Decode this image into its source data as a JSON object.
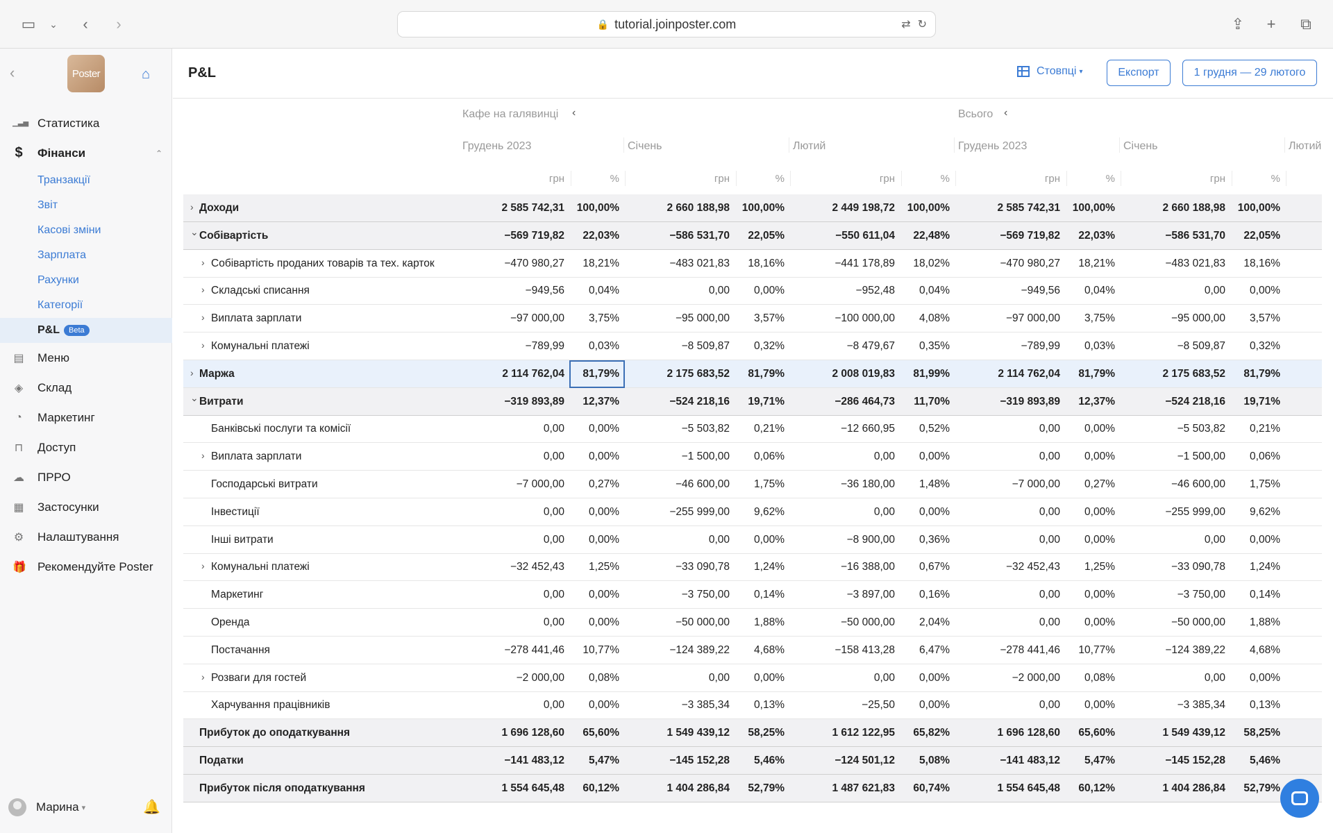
{
  "browser": {
    "url": "tutorial.joinposter.com"
  },
  "sidebar": {
    "logo_text": "Poster",
    "items": [
      {
        "label": "Статистика",
        "icon": "bar-chart-icon"
      },
      {
        "label": "Фінанси",
        "icon": "dollar-icon",
        "expanded": true,
        "children": [
          {
            "label": "Транзакції"
          },
          {
            "label": "Звіт"
          },
          {
            "label": "Касові зміни"
          },
          {
            "label": "Зарплата"
          },
          {
            "label": "Рахунки"
          },
          {
            "label": "Категорії"
          },
          {
            "label": "P&L",
            "badge": "Beta",
            "active": true
          }
        ]
      },
      {
        "label": "Меню",
        "icon": "document-icon"
      },
      {
        "label": "Склад",
        "icon": "layers-icon"
      },
      {
        "label": "Маркетинг",
        "icon": "pie-icon"
      },
      {
        "label": "Доступ",
        "icon": "lock-icon"
      },
      {
        "label": "ПРРО",
        "icon": "cloud-icon"
      },
      {
        "label": "Застосунки",
        "icon": "apps-icon"
      },
      {
        "label": "Налаштування",
        "icon": "gear-icon"
      },
      {
        "label": "Рекомендуйте Poster",
        "icon": "gift-icon"
      }
    ],
    "user": "Марина"
  },
  "header": {
    "title": "P&L",
    "columns_label": "Стовпці",
    "export_label": "Експорт",
    "date_range": "1 грудня — 29 лютого"
  },
  "table": {
    "groups": [
      "Кафе на галявинці",
      "Всього"
    ],
    "months": [
      "Грудень 2023",
      "Січень",
      "Лютий",
      "Грудень 2023",
      "Січень",
      "Лютий"
    ],
    "unit_money": "грн",
    "unit_pct": "%",
    "rows": [
      {
        "label": "Доходи",
        "type": "section",
        "chevron": "›",
        "indent": 0,
        "values": [
          "2 585 742,31",
          "100,00%",
          "2 660 188,98",
          "100,00%",
          "2 449 198,72",
          "100,00%",
          "2 585 742,31",
          "100,00%",
          "2 660 188,98",
          "100,00%"
        ]
      },
      {
        "label": "Собівартість",
        "type": "section",
        "chevron": "⌄",
        "indent": 0,
        "values": [
          "−569 719,82",
          "22,03%",
          "−586 531,70",
          "22,05%",
          "−550 611,04",
          "22,48%",
          "−569 719,82",
          "22,03%",
          "−586 531,70",
          "22,05%"
        ]
      },
      {
        "label": "Собівартість проданих товарів та тех. карток",
        "type": "item",
        "chevron": "›",
        "indent": 1,
        "values": [
          "−470 980,27",
          "18,21%",
          "−483 021,83",
          "18,16%",
          "−441 178,89",
          "18,02%",
          "−470 980,27",
          "18,21%",
          "−483 021,83",
          "18,16%"
        ]
      },
      {
        "label": "Складські списання",
        "type": "item",
        "chevron": "›",
        "indent": 1,
        "values": [
          "−949,56",
          "0,04%",
          "0,00",
          "0,00%",
          "−952,48",
          "0,04%",
          "−949,56",
          "0,04%",
          "0,00",
          "0,00%"
        ]
      },
      {
        "label": "Виплата зарплати",
        "type": "item",
        "chevron": "›",
        "indent": 1,
        "values": [
          "−97 000,00",
          "3,75%",
          "−95 000,00",
          "3,57%",
          "−100 000,00",
          "4,08%",
          "−97 000,00",
          "3,75%",
          "−95 000,00",
          "3,57%"
        ]
      },
      {
        "label": "Комунальні платежі",
        "type": "item",
        "chevron": "›",
        "indent": 1,
        "values": [
          "−789,99",
          "0,03%",
          "−8 509,87",
          "0,32%",
          "−8 479,67",
          "0,35%",
          "−789,99",
          "0,03%",
          "−8 509,87",
          "0,32%"
        ]
      },
      {
        "label": "Маржа",
        "type": "highlight",
        "chevron": "›",
        "indent": 0,
        "values": [
          "2 114 762,04",
          "81,79%",
          "2 175 683,52",
          "81,79%",
          "2 008 019,83",
          "81,99%",
          "2 114 762,04",
          "81,79%",
          "2 175 683,52",
          "81,79%"
        ]
      },
      {
        "label": "Витрати",
        "type": "section",
        "chevron": "⌄",
        "indent": 0,
        "values": [
          "−319 893,89",
          "12,37%",
          "−524 218,16",
          "19,71%",
          "−286 464,73",
          "11,70%",
          "−319 893,89",
          "12,37%",
          "−524 218,16",
          "19,71%"
        ]
      },
      {
        "label": "Банківські послуги та комісії",
        "type": "item",
        "chevron": "",
        "indent": 1,
        "values": [
          "0,00",
          "0,00%",
          "−5 503,82",
          "0,21%",
          "−12 660,95",
          "0,52%",
          "0,00",
          "0,00%",
          "−5 503,82",
          "0,21%"
        ]
      },
      {
        "label": "Виплата зарплати",
        "type": "item",
        "chevron": "›",
        "indent": 1,
        "values": [
          "0,00",
          "0,00%",
          "−1 500,00",
          "0,06%",
          "0,00",
          "0,00%",
          "0,00",
          "0,00%",
          "−1 500,00",
          "0,06%"
        ]
      },
      {
        "label": "Господарські витрати",
        "type": "item",
        "chevron": "",
        "indent": 1,
        "values": [
          "−7 000,00",
          "0,27%",
          "−46 600,00",
          "1,75%",
          "−36 180,00",
          "1,48%",
          "−7 000,00",
          "0,27%",
          "−46 600,00",
          "1,75%"
        ]
      },
      {
        "label": "Інвестиції",
        "type": "item",
        "chevron": "",
        "indent": 1,
        "values": [
          "0,00",
          "0,00%",
          "−255 999,00",
          "9,62%",
          "0,00",
          "0,00%",
          "0,00",
          "0,00%",
          "−255 999,00",
          "9,62%"
        ]
      },
      {
        "label": "Інші витрати",
        "type": "item",
        "chevron": "",
        "indent": 1,
        "values": [
          "0,00",
          "0,00%",
          "0,00",
          "0,00%",
          "−8 900,00",
          "0,36%",
          "0,00",
          "0,00%",
          "0,00",
          "0,00%"
        ]
      },
      {
        "label": "Комунальні платежі",
        "type": "item",
        "chevron": "›",
        "indent": 1,
        "values": [
          "−32 452,43",
          "1,25%",
          "−33 090,78",
          "1,24%",
          "−16 388,00",
          "0,67%",
          "−32 452,43",
          "1,25%",
          "−33 090,78",
          "1,24%"
        ]
      },
      {
        "label": "Маркетинг",
        "type": "item",
        "chevron": "",
        "indent": 1,
        "values": [
          "0,00",
          "0,00%",
          "−3 750,00",
          "0,14%",
          "−3 897,00",
          "0,16%",
          "0,00",
          "0,00%",
          "−3 750,00",
          "0,14%"
        ]
      },
      {
        "label": "Оренда",
        "type": "item",
        "chevron": "",
        "indent": 1,
        "values": [
          "0,00",
          "0,00%",
          "−50 000,00",
          "1,88%",
          "−50 000,00",
          "2,04%",
          "0,00",
          "0,00%",
          "−50 000,00",
          "1,88%"
        ]
      },
      {
        "label": "Постачання",
        "type": "item",
        "chevron": "",
        "indent": 1,
        "values": [
          "−278 441,46",
          "10,77%",
          "−124 389,22",
          "4,68%",
          "−158 413,28",
          "6,47%",
          "−278 441,46",
          "10,77%",
          "−124 389,22",
          "4,68%"
        ]
      },
      {
        "label": "Розваги для гостей",
        "type": "item",
        "chevron": "›",
        "indent": 1,
        "values": [
          "−2 000,00",
          "0,08%",
          "0,00",
          "0,00%",
          "0,00",
          "0,00%",
          "−2 000,00",
          "0,08%",
          "0,00",
          "0,00%"
        ]
      },
      {
        "label": "Харчування працівників",
        "type": "item",
        "chevron": "",
        "indent": 1,
        "values": [
          "0,00",
          "0,00%",
          "−3 385,34",
          "0,13%",
          "−25,50",
          "0,00%",
          "0,00",
          "0,00%",
          "−3 385,34",
          "0,13%"
        ]
      },
      {
        "label": "Прибуток до оподаткування",
        "type": "total",
        "chevron": "",
        "indent": 0,
        "values": [
          "1 696 128,60",
          "65,60%",
          "1 549 439,12",
          "58,25%",
          "1 612 122,95",
          "65,82%",
          "1 696 128,60",
          "65,60%",
          "1 549 439,12",
          "58,25%"
        ]
      },
      {
        "label": "Податки",
        "type": "total",
        "chevron": "",
        "indent": 0,
        "values": [
          "−141 483,12",
          "5,47%",
          "−145 152,28",
          "5,46%",
          "−124 501,12",
          "5,08%",
          "−141 483,12",
          "5,47%",
          "−145 152,28",
          "5,46%"
        ]
      },
      {
        "label": "Прибуток після оподаткування",
        "type": "total",
        "chevron": "",
        "indent": 0,
        "values": [
          "1 554 645,48",
          "60,12%",
          "1 404 286,84",
          "52,79%",
          "1 487 621,83",
          "60,74%",
          "1 554 645,48",
          "60,12%",
          "1 404 286,84",
          "52,79%"
        ]
      }
    ]
  }
}
